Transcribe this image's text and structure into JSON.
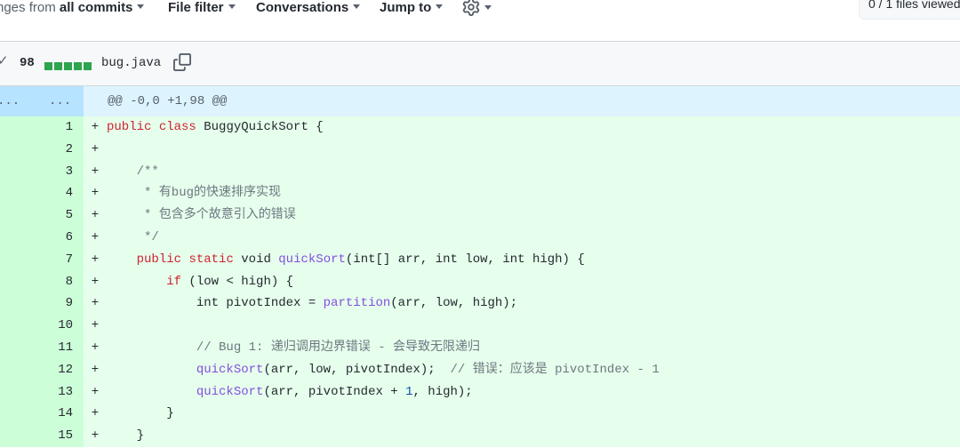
{
  "toolbar": {
    "commits_prefix": "nges from",
    "commits_strong": "all commits",
    "file_filter": "File filter",
    "conversations": "Conversations",
    "jump_to": "Jump to",
    "files_viewed": "0 / 1 files viewed"
  },
  "file": {
    "additions": "98",
    "name": "bug.java"
  },
  "hunk": {
    "left_dots": "...",
    "right_dots": "...",
    "header": "@@ -0,0 +1,98 @@"
  },
  "lines": [
    {
      "num": "1",
      "marker": "+"
    },
    {
      "num": "2",
      "marker": "+"
    },
    {
      "num": "3",
      "marker": "+"
    },
    {
      "num": "4",
      "marker": "+"
    },
    {
      "num": "5",
      "marker": "+"
    },
    {
      "num": "6",
      "marker": "+"
    },
    {
      "num": "7",
      "marker": "+"
    },
    {
      "num": "8",
      "marker": "+"
    },
    {
      "num": "9",
      "marker": "+"
    },
    {
      "num": "10",
      "marker": "+"
    },
    {
      "num": "11",
      "marker": "+"
    },
    {
      "num": "12",
      "marker": "+"
    },
    {
      "num": "13",
      "marker": "+"
    },
    {
      "num": "14",
      "marker": "+"
    },
    {
      "num": "15",
      "marker": "+"
    }
  ],
  "code": {
    "l1": {
      "kw1": "public",
      "kw2": "class",
      "rest": " BuggyQuickSort {"
    },
    "l3": "    /**",
    "l4": "     * 有bug的快速排序实现",
    "l5": "     * 包含多个故意引入的错误",
    "l6": "     */",
    "l7": {
      "indent": "    ",
      "kw1": "public",
      "kw2": "static",
      "type": " void ",
      "fn": "quickSort",
      "rest": "(int[] arr, int low, int high) {"
    },
    "l8": {
      "indent": "        ",
      "kw": "if",
      "rest": " (low < high) {"
    },
    "l9": {
      "indent": "            ",
      "pre": "int pivotIndex = ",
      "fn": "partition",
      "rest": "(arr, low, high);"
    },
    "l11": "            // Bug 1: 递归调用边界错误 - 会导致无限递归",
    "l12": {
      "indent": "            ",
      "fn": "quickSort",
      "rest": "(arr, low, pivotIndex);  ",
      "comment": "// 错误：应该是 pivotIndex - 1"
    },
    "l13": {
      "indent": "            ",
      "fn": "quickSort",
      "pre": "(arr, pivotIndex + ",
      "num": "1",
      "rest": ", high);"
    },
    "l14": "        }",
    "l15": "    }"
  },
  "colors": {
    "added_bg": "#e6ffec",
    "added_gutter": "#ccffd8",
    "hunk_bg": "#ddf4ff",
    "keyword": "#cf222e",
    "function": "#8250df",
    "diffstat": "#2da44e"
  }
}
